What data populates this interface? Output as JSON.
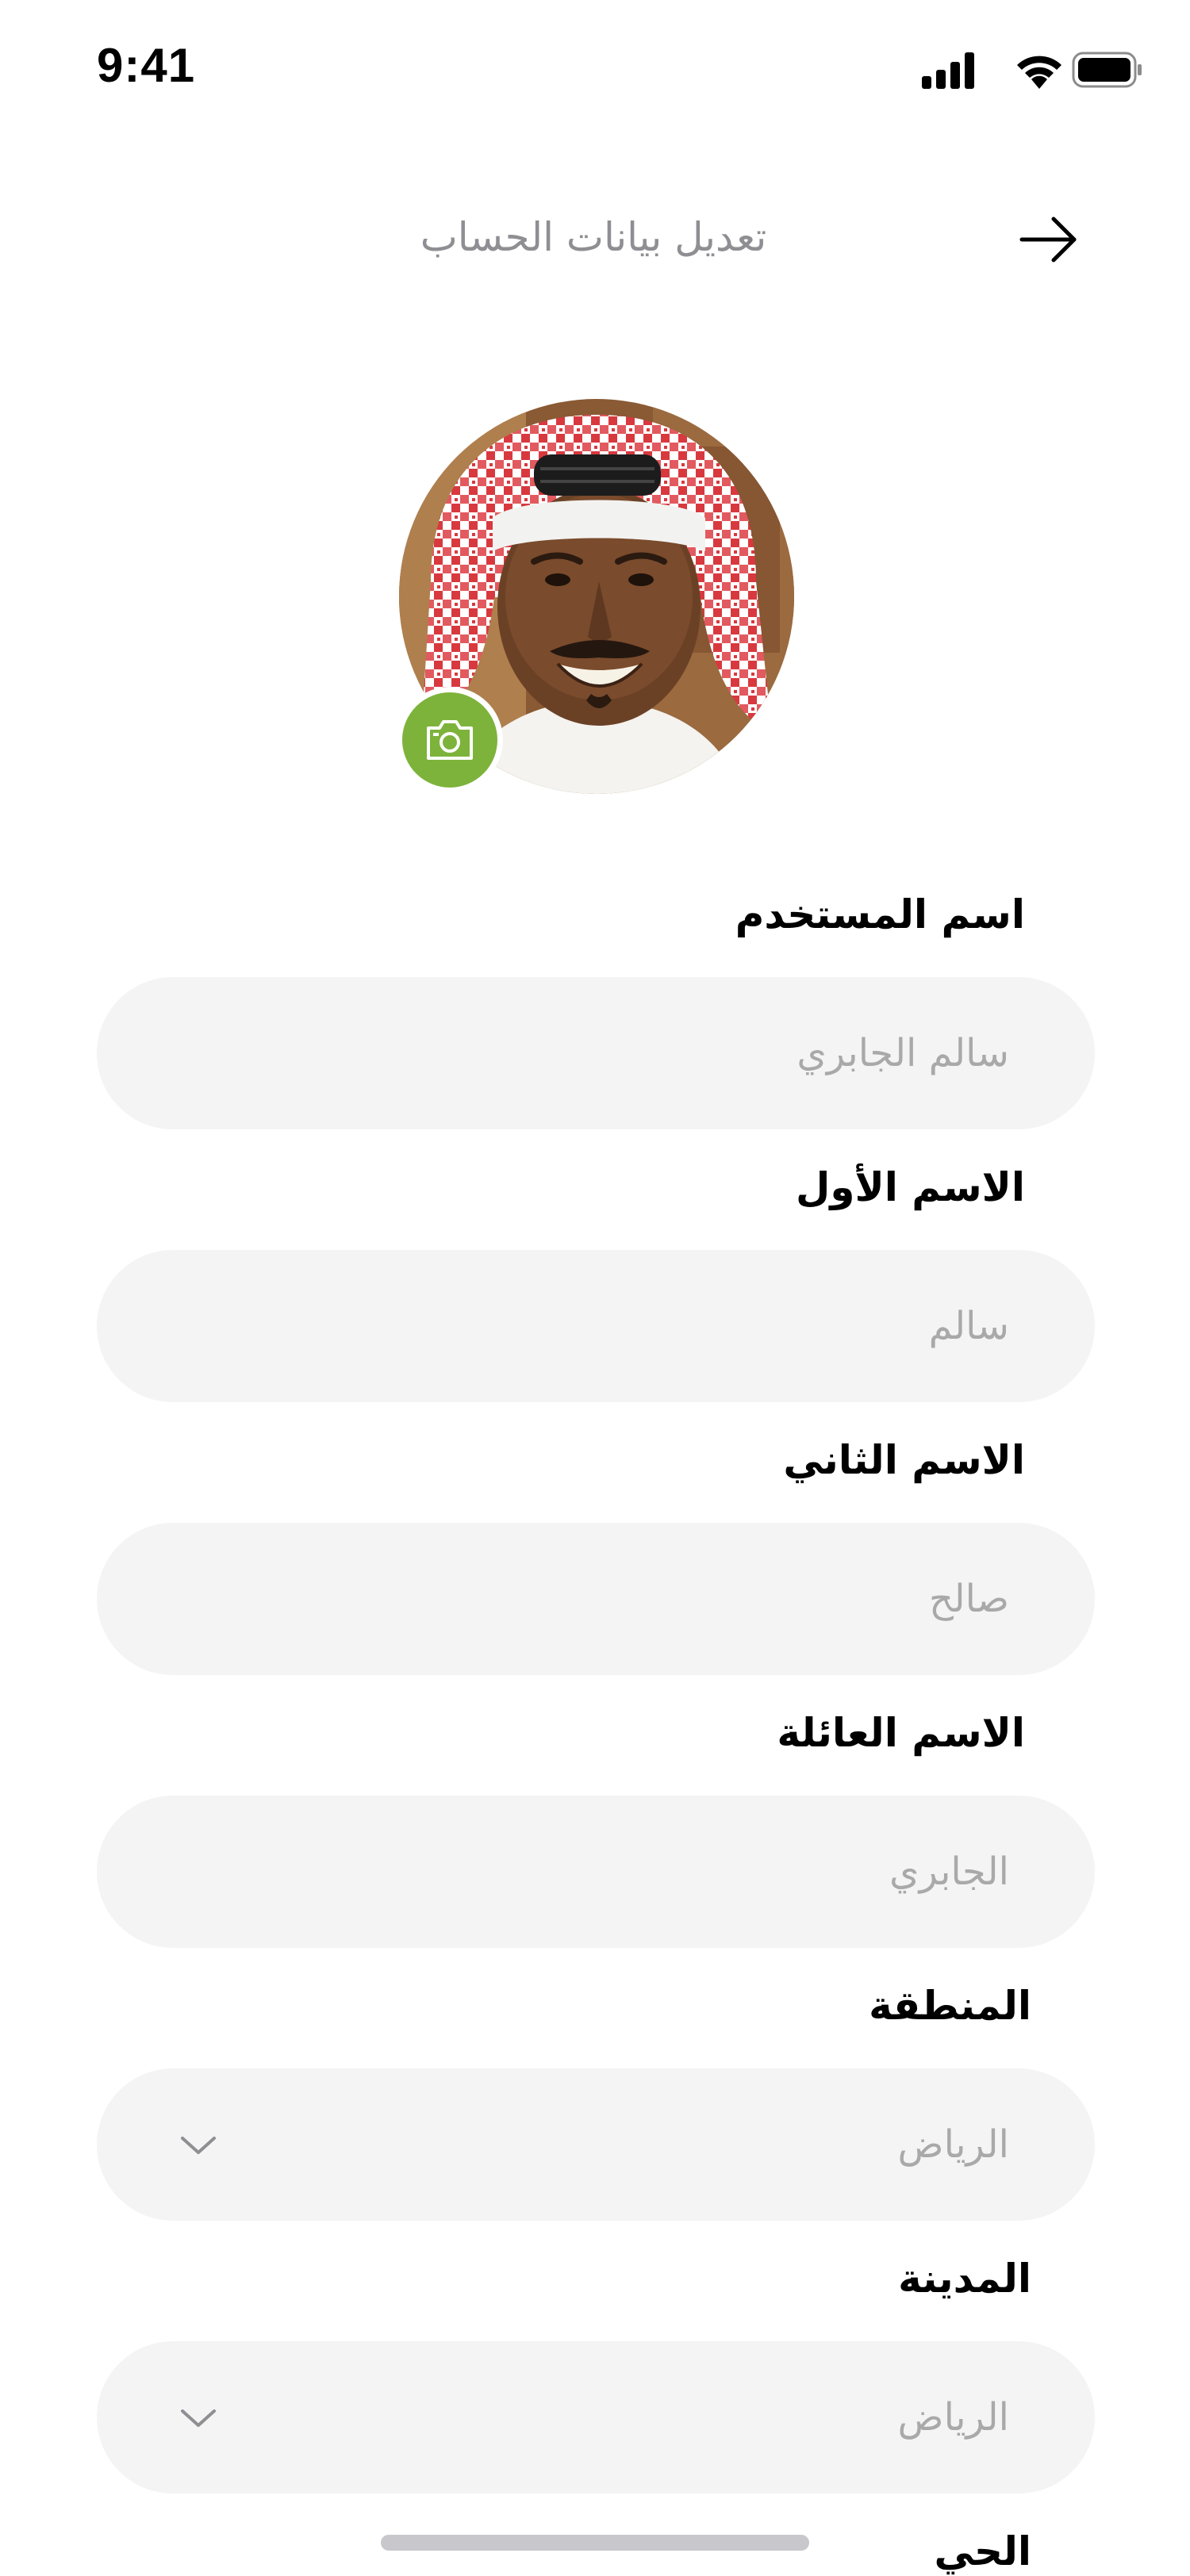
{
  "status_bar": {
    "time": "9:41"
  },
  "header": {
    "title": "تعديل بيانات الحساب"
  },
  "avatar": {
    "camera_icon": "camera-icon"
  },
  "form": {
    "fields": [
      {
        "label": "اسم المستخدم",
        "value": "سالم الجابري",
        "type": "text"
      },
      {
        "label": "الاسم الأول",
        "value": "سالم",
        "type": "text"
      },
      {
        "label": "الاسم الثاني",
        "value": "صالح",
        "type": "text"
      },
      {
        "label": "الاسم العائلة",
        "value": "الجابري",
        "type": "text"
      },
      {
        "label": "المنطقة",
        "value": "الرياض",
        "type": "select"
      },
      {
        "label": "المدينة",
        "value": "الرياض",
        "type": "select"
      },
      {
        "label": "الحي"
      }
    ]
  },
  "colors": {
    "accent": "#7db33b",
    "field_background": "#f4f4f4",
    "placeholder_text": "#a9a9a9",
    "header_text": "#8e8e93"
  }
}
